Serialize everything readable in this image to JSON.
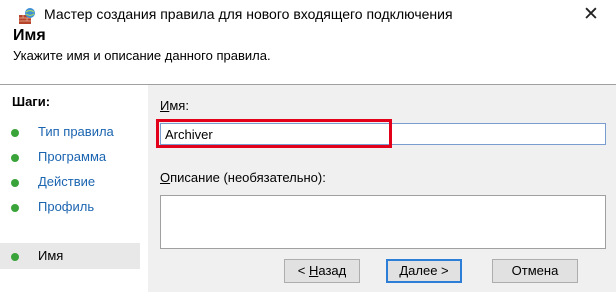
{
  "window": {
    "title": "Мастер создания правила для нового входящего подключения",
    "icon": "firewall-wizard-icon",
    "close_glyph": "✕"
  },
  "header": {
    "title": "Имя",
    "subtitle": "Укажите имя и описание данного правила."
  },
  "steps": {
    "header": "Шаги:",
    "items": [
      {
        "label": "Тип правила",
        "state": "link"
      },
      {
        "label": "Программа",
        "state": "link"
      },
      {
        "label": "Действие",
        "state": "link"
      },
      {
        "label": "Профиль",
        "state": "link"
      },
      {
        "label": "Имя",
        "state": "current"
      }
    ]
  },
  "form": {
    "name_label_mnemonic": "И",
    "name_label_rest": "мя:",
    "name_value": "Archiver",
    "desc_label_mnemonic": "О",
    "desc_label_rest": "писание (необязательно):",
    "desc_value": ""
  },
  "buttons": {
    "back_prefix": "< ",
    "back_mnemonic": "Н",
    "back_rest": "азад",
    "next_mnemonic": "Д",
    "next_rest": "алее >",
    "cancel": "Отмена"
  },
  "colors": {
    "highlight": "#e3001b",
    "step_dot": "#3aa33a",
    "step_link": "#1b64b0",
    "content_bg": "#f0f0f0"
  }
}
